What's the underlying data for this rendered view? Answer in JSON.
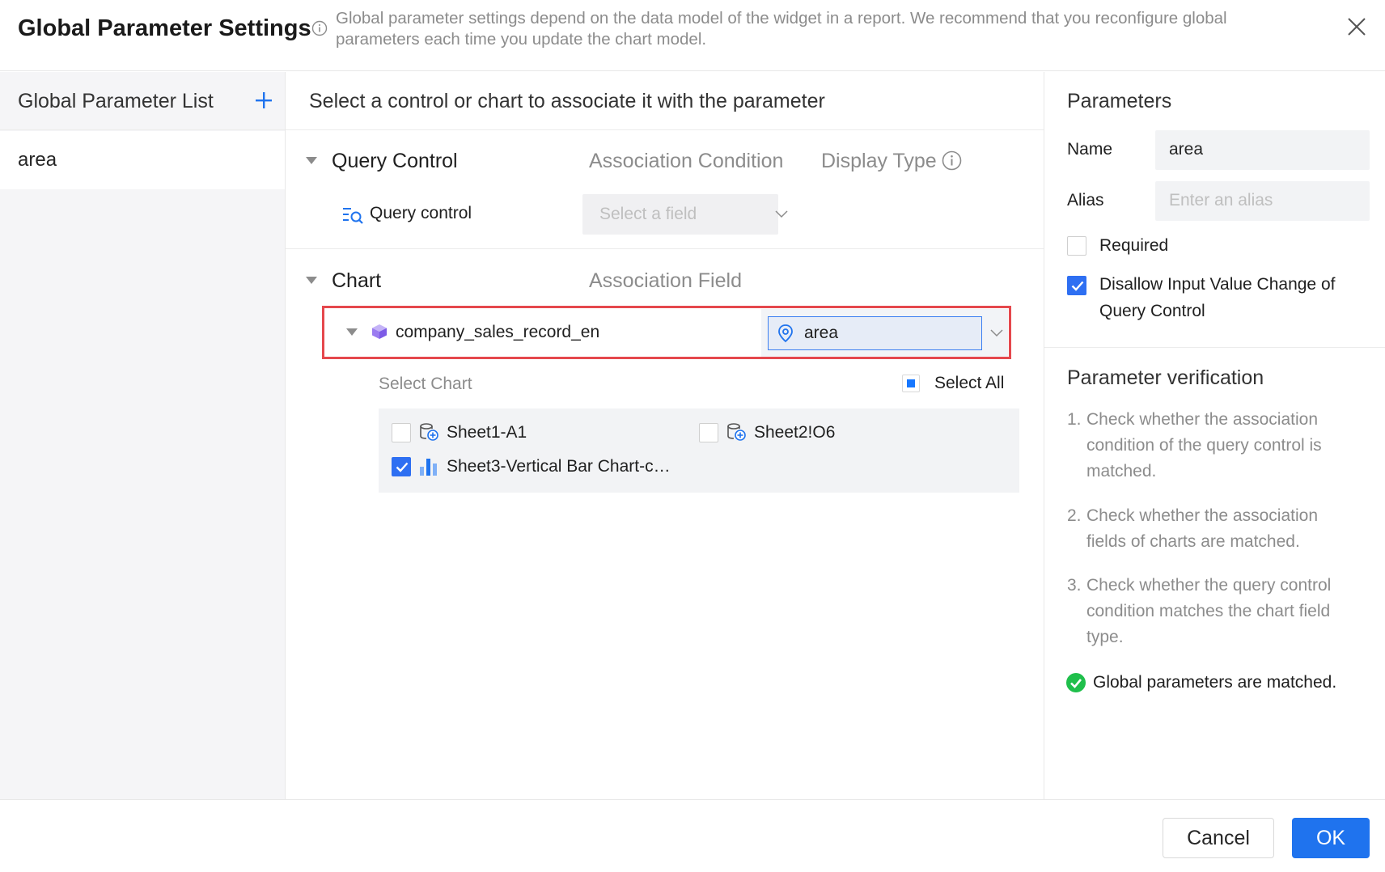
{
  "dialog": {
    "title": "Global Parameter Settings",
    "description": "Global parameter settings depend on the data model of the widget in a report. We recommend that you reconfigure global parameters each time you update the chart model."
  },
  "left_panel": {
    "header": "Global Parameter List",
    "items": [
      {
        "label": "area"
      }
    ]
  },
  "middle_panel": {
    "header": "Select a control or chart to associate it with the parameter",
    "query_control": {
      "section_label": "Query Control",
      "col_condition": "Association Condition",
      "col_display_type": "Display Type",
      "row_label": "Query control",
      "field_placeholder": "Select a field"
    },
    "chart": {
      "section_label": "Chart",
      "col_field": "Association Field",
      "dataset_label": "company_sales_record_en",
      "dataset_field": "area",
      "select_chart_label": "Select Chart",
      "select_all_label": "Select All",
      "charts": [
        {
          "label": "Sheet1-A1",
          "checked": false
        },
        {
          "label": "Sheet2!O6",
          "checked": false
        },
        {
          "label": "Sheet3-Vertical Bar Chart-c…",
          "checked": true
        }
      ]
    }
  },
  "right_panel": {
    "parameters_title": "Parameters",
    "name_label": "Name",
    "name_value": "area",
    "alias_label": "Alias",
    "alias_placeholder": "Enter an alias",
    "required_label": "Required",
    "required_checked": false,
    "disallow_label_line1": "Disallow Input Value Change of",
    "disallow_label_line2": "Query Control",
    "disallow_checked": true,
    "verification_title": "Parameter verification",
    "verification_items": [
      {
        "num": "1.",
        "text": "Check whether the association condition of the query control is matched."
      },
      {
        "num": "2.",
        "text": "Check whether the association fields of charts are matched."
      },
      {
        "num": "3.",
        "text": "Check whether the query control condition matches the chart field type."
      }
    ],
    "result": "Global parameters are matched."
  },
  "footer": {
    "cancel_label": "Cancel",
    "ok_label": "OK"
  },
  "colors": {
    "primary": "#1f73ee",
    "highlight_border": "#e5484d",
    "success": "#1fbf4b",
    "cube_icon": "#9b7cf0"
  },
  "icons": {
    "info": "info-circle-icon",
    "close": "close-icon",
    "add": "plus-icon",
    "query_control": "filter-search-icon",
    "dataset": "cube-icon",
    "field": "location-pin-icon",
    "sheet": "sheet-link-icon",
    "bar_chart": "bar-chart-icon",
    "success": "check-circle-icon"
  }
}
